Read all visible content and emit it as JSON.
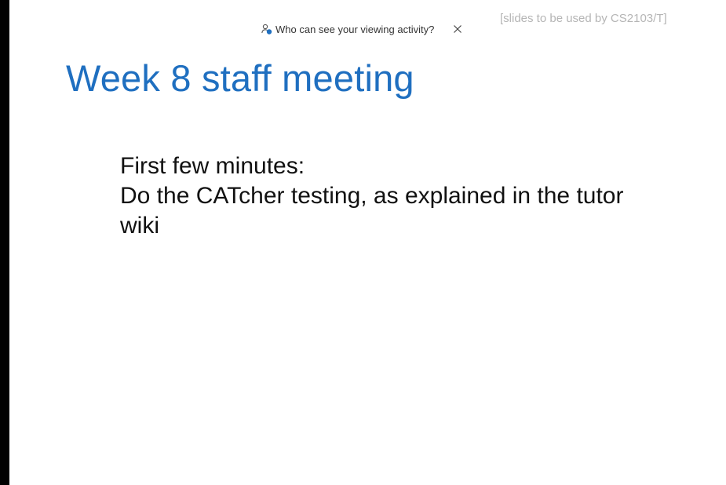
{
  "notice": {
    "text": "Who can see your viewing activity?",
    "icon": "viewers-icon",
    "close_icon": "close-icon"
  },
  "slide": {
    "tag": "[slides to be used by CS2103/T]",
    "title": "Week 8 staff meeting",
    "body_lines": [
      "First few minutes:",
      "Do the CATcher testing, as explained in the tutor",
      "wiki"
    ]
  },
  "colors": {
    "title": "#1f6fc0",
    "tag": "#b5b5b5",
    "body": "#111111",
    "icon_accent": "#1f6fc0"
  }
}
